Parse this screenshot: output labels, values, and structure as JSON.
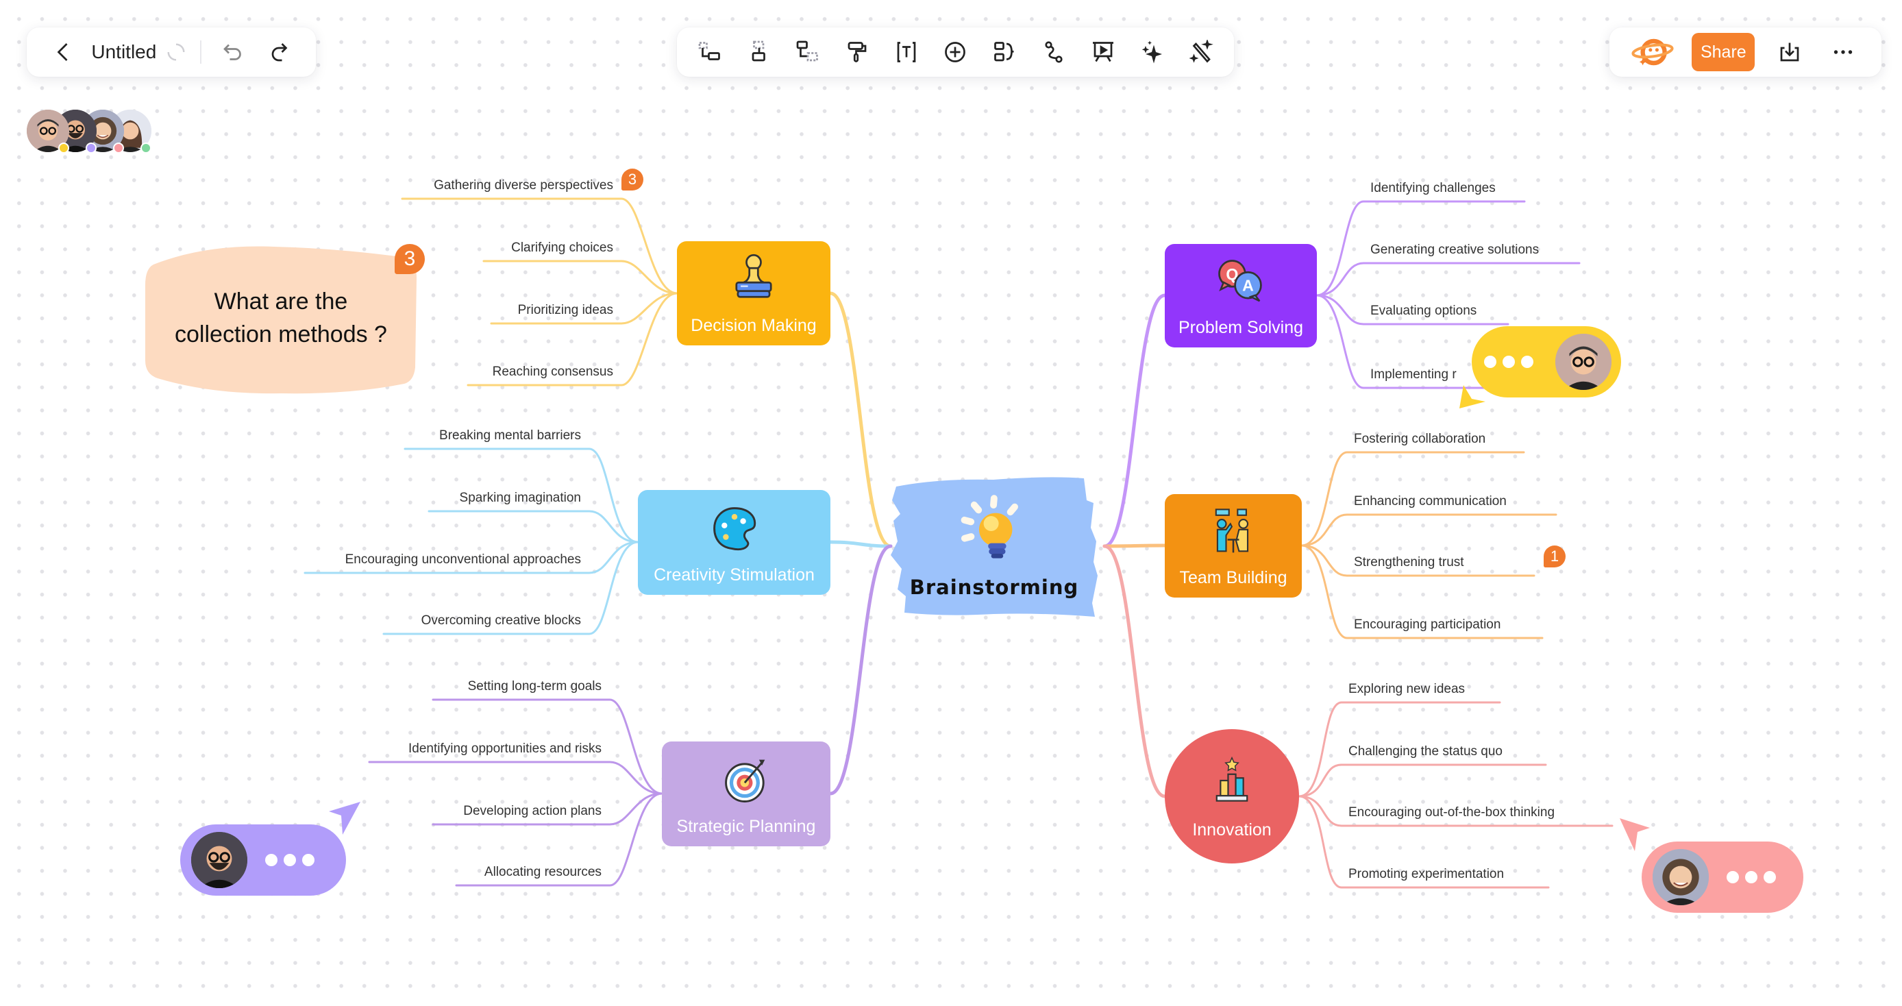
{
  "header": {
    "back_icon": "chevron-left-icon",
    "title": "Untitled",
    "sync_icon": "loading-spinner-icon",
    "undo_icon": "undo-icon",
    "redo_icon": "redo-icon"
  },
  "toolbar": {
    "tools": [
      {
        "name": "insert-parent-topic",
        "icon": "insert-parent-topic-icon"
      },
      {
        "name": "insert-subtopic",
        "icon": "insert-subtopic-icon"
      },
      {
        "name": "insert-sibling-topic",
        "icon": "insert-sibling-topic-icon"
      },
      {
        "name": "format-painter",
        "icon": "paint-roller-icon"
      },
      {
        "name": "text",
        "icon": "text-box-icon"
      },
      {
        "name": "insert",
        "icon": "plus-circle-icon"
      },
      {
        "name": "summary",
        "icon": "summary-bracket-icon"
      },
      {
        "name": "relationship",
        "icon": "connector-curve-icon"
      },
      {
        "name": "presentation",
        "icon": "presentation-board-icon"
      },
      {
        "name": "ai-generate",
        "icon": "sparkle-icon"
      },
      {
        "name": "magic-wand",
        "icon": "magic-wand-icon"
      }
    ]
  },
  "right_panel": {
    "ai_logo": "planet-logo-icon",
    "share_label": "Share",
    "download_icon": "download-icon",
    "more_icon": "more-horizontal-icon"
  },
  "collaborators": [
    {
      "name": "user-1",
      "status_color": "#f9cf2f"
    },
    {
      "name": "user-2",
      "status_color": "#b09cfc"
    },
    {
      "name": "user-3",
      "status_color": "#fa9aa0"
    },
    {
      "name": "user-4",
      "status_color": "#7ed79c"
    }
  ],
  "mindmap": {
    "central": {
      "label": "Brainstorming",
      "color": "#9cc2fb"
    },
    "branches": [
      {
        "label": "Decision Making",
        "color": "#fbb40f",
        "line_color": "#fcd57a",
        "icon": "stamp-icon",
        "children": [
          "Gathering diverse perspectives",
          "Clarifying choices",
          "Prioritizing ideas",
          "Reaching consensus"
        ],
        "badges": {
          "0": "3"
        }
      },
      {
        "label": "Creativity Stimulation",
        "color": "#83d3f9",
        "line_color": "#a3ddf7",
        "icon": "palette-icon",
        "children": [
          "Breaking mental barriers",
          "Sparking imagination",
          "Encouraging unconventional approaches",
          "Overcoming creative blocks"
        ]
      },
      {
        "label": "Strategic Planning",
        "color": "#c4a8e4",
        "line_color": "#bc96ea",
        "icon": "target-icon",
        "children": [
          "Setting long-term goals",
          "Identifying opportunities and risks",
          "Developing action plans",
          "Allocating resources"
        ]
      },
      {
        "label": "Problem Solving",
        "color": "#9236fb",
        "line_color": "#c495f8",
        "icon": "qa-chat-icon",
        "children": [
          "Identifying challenges",
          "Generating creative solutions",
          "Evaluating options",
          "Implementing r"
        ]
      },
      {
        "label": "Team Building",
        "color": "#f39212",
        "line_color": "#fbc07d",
        "icon": "team-meeting-icon",
        "children": [
          "Fostering collaboration",
          "Enhancing communication",
          "Strengthening trust",
          "Encouraging participation"
        ],
        "badges": {
          "2": "1"
        }
      },
      {
        "label": "Innovation",
        "color": "#ea6363",
        "line_color": "#f5a9a9",
        "icon": "podium-star-icon",
        "children": [
          "Exploring new ideas",
          "Challenging the status quo",
          "Encouraging out-of-the-box thinking",
          "Promoting experimentation"
        ]
      }
    ]
  },
  "question_note": {
    "text_line1": "What are the",
    "text_line2": "collection methods ?",
    "badge": "3",
    "color": "#fddbc1"
  },
  "chat_bubbles": [
    {
      "name": "yellow-user-typing",
      "color": "#fdd22e"
    },
    {
      "name": "purple-user-typing",
      "color": "#b19dfa"
    },
    {
      "name": "pink-user-typing",
      "color": "#fba2a2"
    }
  ]
}
